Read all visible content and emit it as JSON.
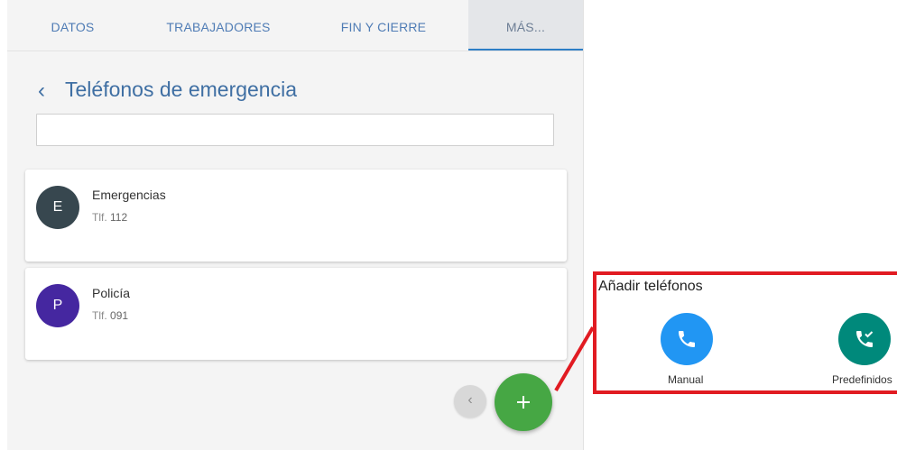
{
  "tabs": [
    {
      "label": "DATOS"
    },
    {
      "label": "TRABAJADORES"
    },
    {
      "label": "FIN Y CIERRE"
    },
    {
      "label": "MÁS..."
    }
  ],
  "page": {
    "title": "Teléfonos de emergencia",
    "back_icon": "‹"
  },
  "search": {
    "value": "",
    "placeholder": ""
  },
  "contacts": [
    {
      "initial": "E",
      "name": "Emergencias",
      "phone_prefix": "Tlf.",
      "phone": "112",
      "avatar_color": "#37474f"
    },
    {
      "initial": "P",
      "name": "Policía",
      "phone_prefix": "Tlf.",
      "phone": "091",
      "avatar_color": "#4527a0"
    }
  ],
  "buttons": {
    "collapse_icon": "‹",
    "fab_icon": "plus-icon"
  },
  "add_phones": {
    "title": "Añadir teléfonos",
    "manual_label": "Manual",
    "predefined_label": "Predefinidos",
    "manual_color": "#2196f3",
    "predefined_color": "#00897b",
    "callout_color": "#e11b22"
  }
}
